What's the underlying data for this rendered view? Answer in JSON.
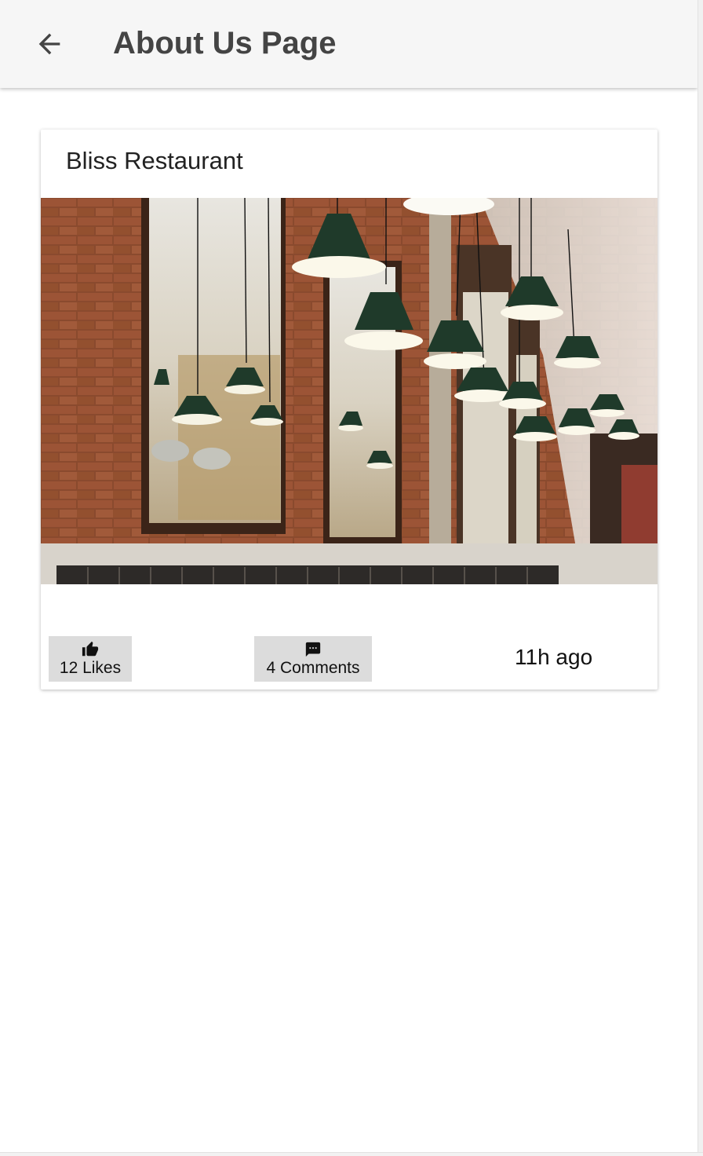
{
  "header": {
    "back_icon": "arrow-left-icon",
    "title": "About Us Page"
  },
  "card": {
    "title": "Bliss Restaurant",
    "image": "restaurant interior photo",
    "likes": {
      "icon": "thumb-up-icon",
      "label": "12 Likes"
    },
    "comments": {
      "icon": "comment-icon",
      "label": "4 Comments"
    },
    "time_ago": "11h ago"
  },
  "colors": {
    "app_bar_bg": "#f6f6f6",
    "title_text": "#444444",
    "action_button_bg": "#dcdcdc"
  }
}
